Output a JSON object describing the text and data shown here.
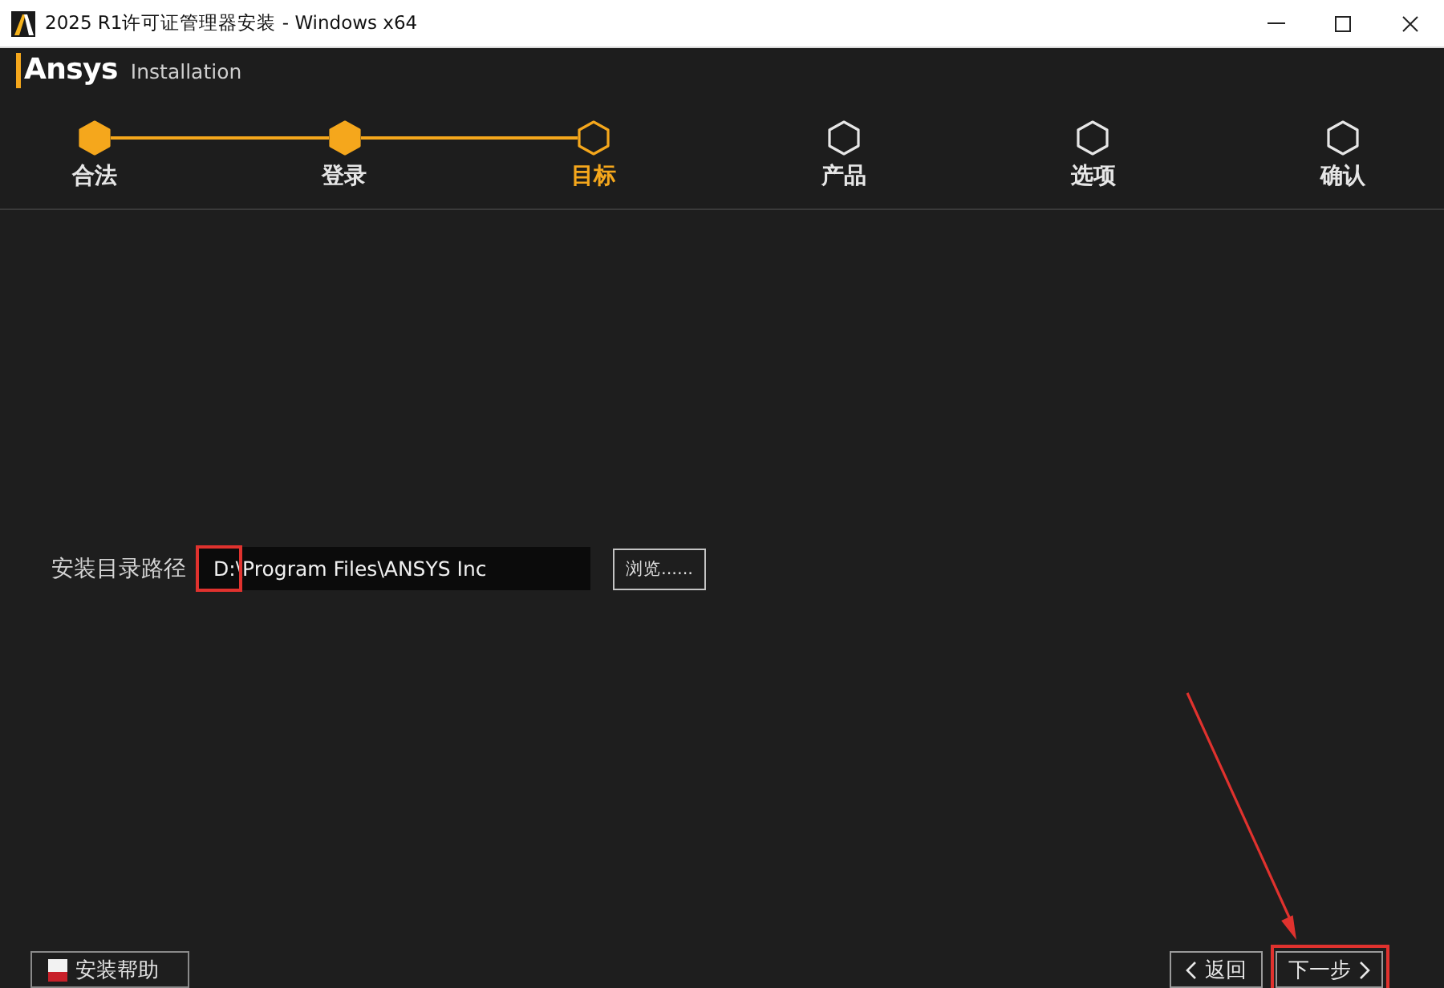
{
  "window": {
    "title": "2025 R1许可证管理器安装 - Windows x64"
  },
  "header": {
    "logo": "Ansys",
    "subtitle": "Installation"
  },
  "steps": [
    {
      "label": "合法",
      "done": true,
      "selected": false
    },
    {
      "label": "登录",
      "done": true,
      "selected": false
    },
    {
      "label": "目标",
      "done": false,
      "selected": true
    },
    {
      "label": "产品",
      "done": false,
      "selected": false
    },
    {
      "label": "选项",
      "done": false,
      "selected": false
    },
    {
      "label": "确认",
      "done": false,
      "selected": false
    }
  ],
  "install_path": {
    "label": "安装目录路径",
    "value": "D:\\Program Files\\ANSYS Inc",
    "highlight_drive": true,
    "browse_button": "浏览......"
  },
  "help_button": "安装帮助",
  "nav_buttons": [
    {
      "kind": "back",
      "label": "返回",
      "highlighted": false
    },
    {
      "kind": "next",
      "label": "下一步",
      "highlighted": true
    }
  ],
  "pointer_arrow": true
}
